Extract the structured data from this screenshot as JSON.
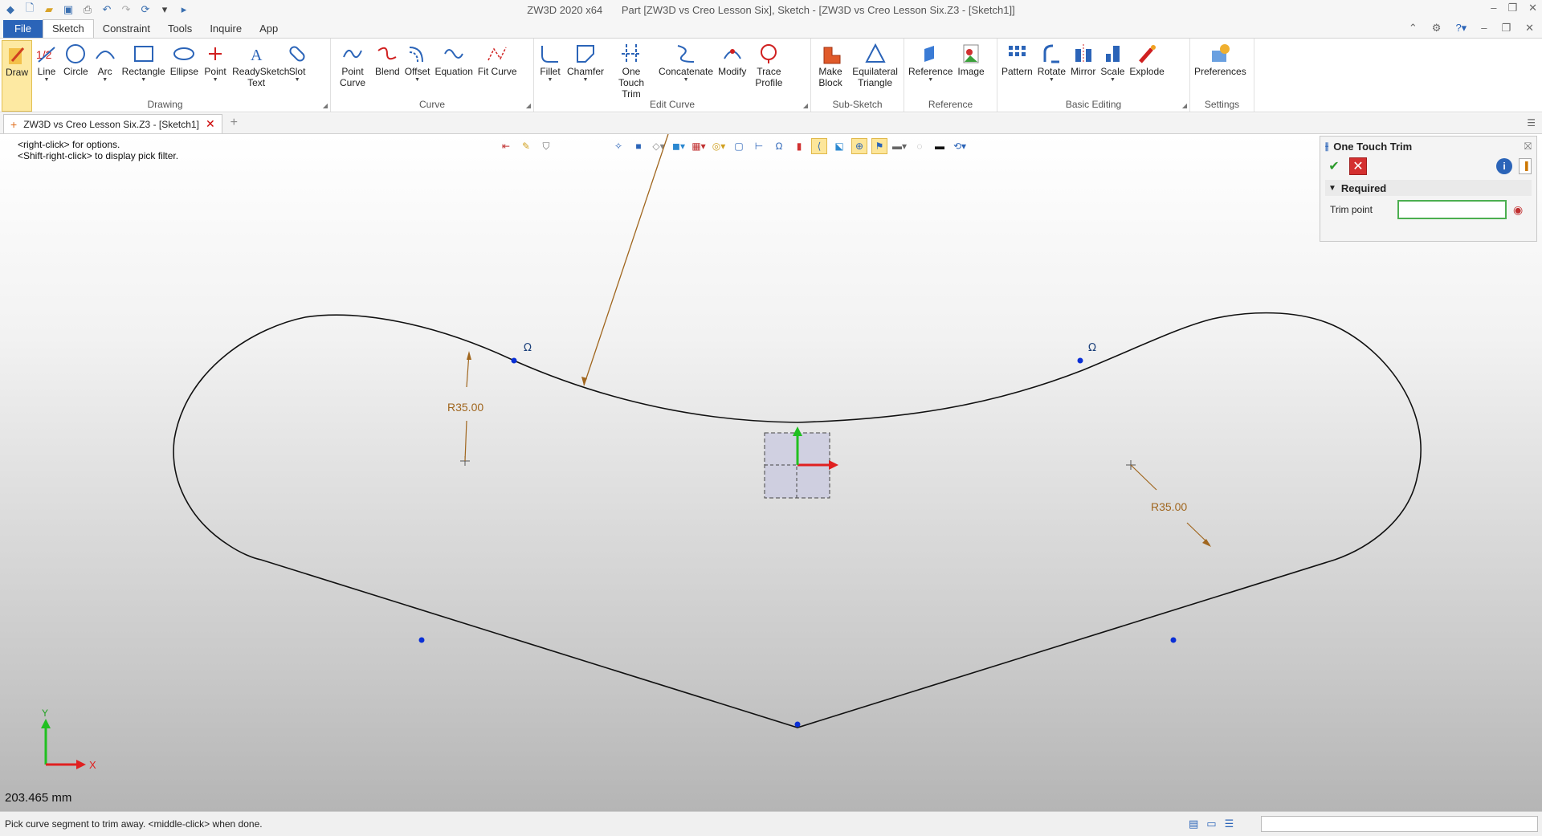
{
  "window": {
    "app_title": "ZW3D 2020 x64",
    "doc_title": "Part [ZW3D vs Creo Lesson Six],  Sketch - [ZW3D vs Creo Lesson Six.Z3 - [Sketch1]]"
  },
  "menu": {
    "tabs": [
      "File",
      "Sketch",
      "Constraint",
      "Tools",
      "Inquire",
      "App"
    ]
  },
  "ribbon": {
    "groups": [
      {
        "label": "Drawing",
        "buttons": [
          {
            "label": "Draw",
            "icon": "draw-pen-icon"
          },
          {
            "label": "Line",
            "icon": "line-icon"
          },
          {
            "label": "Circle",
            "icon": "circle-icon"
          },
          {
            "label": "Arc",
            "icon": "arc-icon"
          },
          {
            "label": "Rectangle",
            "icon": "rectangle-icon"
          },
          {
            "label": "Ellipse",
            "icon": "ellipse-icon"
          },
          {
            "label": "Point",
            "icon": "point-icon"
          },
          {
            "label": "ReadySketch Text",
            "icon": "text-icon"
          },
          {
            "label": "Slot",
            "icon": "slot-icon"
          }
        ]
      },
      {
        "label": "Curve",
        "buttons": [
          {
            "label": "Point Curve",
            "icon": "point-curve-icon"
          },
          {
            "label": "Blend",
            "icon": "blend-icon"
          },
          {
            "label": "Offset",
            "icon": "offset-icon"
          },
          {
            "label": "Equation",
            "icon": "equation-icon"
          },
          {
            "label": "Fit Curve",
            "icon": "fit-curve-icon"
          }
        ]
      },
      {
        "label": "Edit Curve",
        "buttons": [
          {
            "label": "Fillet",
            "icon": "fillet-icon"
          },
          {
            "label": "Chamfer",
            "icon": "chamfer-icon"
          },
          {
            "label": "One Touch Trim",
            "icon": "trim-icon"
          },
          {
            "label": "Concatenate",
            "icon": "concatenate-icon"
          },
          {
            "label": "Modify",
            "icon": "modify-icon"
          },
          {
            "label": "Trace Profile",
            "icon": "trace-profile-icon"
          }
        ]
      },
      {
        "label": "Sub-Sketch",
        "buttons": [
          {
            "label": "Make Block",
            "icon": "make-block-icon"
          },
          {
            "label": "Equilateral Triangle",
            "icon": "triangle-icon"
          }
        ]
      },
      {
        "label": "Reference",
        "buttons": [
          {
            "label": "Reference",
            "icon": "reference-icon"
          },
          {
            "label": "Image",
            "icon": "image-icon"
          }
        ]
      },
      {
        "label": "Basic Editing",
        "buttons": [
          {
            "label": "Pattern",
            "icon": "pattern-icon"
          },
          {
            "label": "Rotate",
            "icon": "rotate-icon"
          },
          {
            "label": "Mirror",
            "icon": "mirror-icon"
          },
          {
            "label": "Scale",
            "icon": "scale-icon"
          },
          {
            "label": "Explode",
            "icon": "explode-icon"
          }
        ]
      },
      {
        "label": "Settings",
        "buttons": [
          {
            "label": "Preferences",
            "icon": "preferences-icon"
          }
        ]
      }
    ]
  },
  "doc_tab": {
    "label": "ZW3D vs Creo Lesson Six.Z3 - [Sketch1]"
  },
  "viewport": {
    "hints": [
      "<right-click> for options.",
      "<Shift-right-click> to display pick filter."
    ],
    "dimensions": [
      "R35.00",
      "R35.00"
    ],
    "tangent_symbol": "Ω",
    "axis_x": "X",
    "axis_y": "Y",
    "readout": "203.465 mm"
  },
  "panel": {
    "title": "One Touch Trim",
    "section": "Required",
    "field_label": "Trim point",
    "field_value": ""
  },
  "status": {
    "prompt": "Pick curve segment to trim away.  <middle-click> when done."
  },
  "colors": {
    "accent": "#2b64b8",
    "dimension": "#a0661e",
    "point": "#0a2fd6",
    "sketch_line": "#111111"
  }
}
